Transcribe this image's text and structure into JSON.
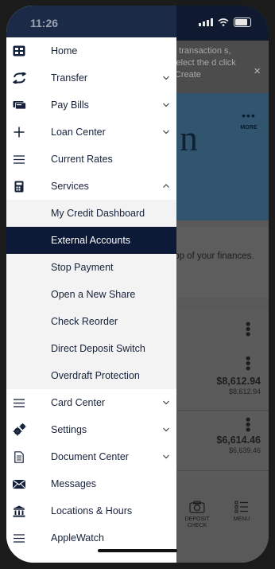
{
  "status_bar": {
    "time": "11:26"
  },
  "background": {
    "notice_text": "d transaction s, select the d click \"Create",
    "notice_close_glyph": "×",
    "hero_letter": "n",
    "more_label": "MORE",
    "tagline": "top of your finances.",
    "accounts": [
      {
        "balance": "$8,612.94",
        "available": "$8,612.94"
      },
      {
        "balance": "$6,614.46",
        "available": "$6,639.46"
      }
    ],
    "tabs": [
      {
        "label": "DEPOSIT CHECK",
        "icon": "camera-icon"
      },
      {
        "label": "MENU",
        "icon": "menu-list-icon"
      }
    ]
  },
  "drawer": {
    "items": [
      {
        "label": "Home",
        "icon": "home-grid-icon",
        "chevron": ""
      },
      {
        "label": "Transfer",
        "icon": "transfer-arrows-icon",
        "chevron": "down"
      },
      {
        "label": "Pay Bills",
        "icon": "bill-card-icon",
        "chevron": "down"
      },
      {
        "label": "Loan Center",
        "icon": "plus-icon",
        "chevron": "down"
      },
      {
        "label": "Current Rates",
        "icon": "lines-icon",
        "chevron": ""
      },
      {
        "label": "Services",
        "icon": "calculator-icon",
        "chevron": "up"
      }
    ],
    "services_submenu": [
      {
        "label": "My Credit Dashboard",
        "active": false
      },
      {
        "label": "External Accounts",
        "active": true
      },
      {
        "label": "Stop Payment",
        "active": false
      },
      {
        "label": "Open a New Share",
        "active": false
      },
      {
        "label": "Check Reorder",
        "active": false
      },
      {
        "label": "Direct Deposit Switch",
        "active": false
      },
      {
        "label": "Overdraft Protection",
        "active": false
      }
    ],
    "items_after": [
      {
        "label": "Card Center",
        "icon": "lines-icon",
        "chevron": "down"
      },
      {
        "label": "Settings",
        "icon": "gears-icon",
        "chevron": "down"
      },
      {
        "label": "Document Center",
        "icon": "document-icon",
        "chevron": "down"
      },
      {
        "label": "Messages",
        "icon": "envelope-icon",
        "chevron": ""
      },
      {
        "label": "Locations & Hours",
        "icon": "bank-building-icon",
        "chevron": ""
      },
      {
        "label": "AppleWatch",
        "icon": "lines-icon",
        "chevron": ""
      }
    ]
  },
  "colors": {
    "drawer_header": "#1a2a47",
    "active_item_bg": "#0d1a37",
    "submenu_bg": "#f3f3f3",
    "text_primary": "#15213a"
  }
}
